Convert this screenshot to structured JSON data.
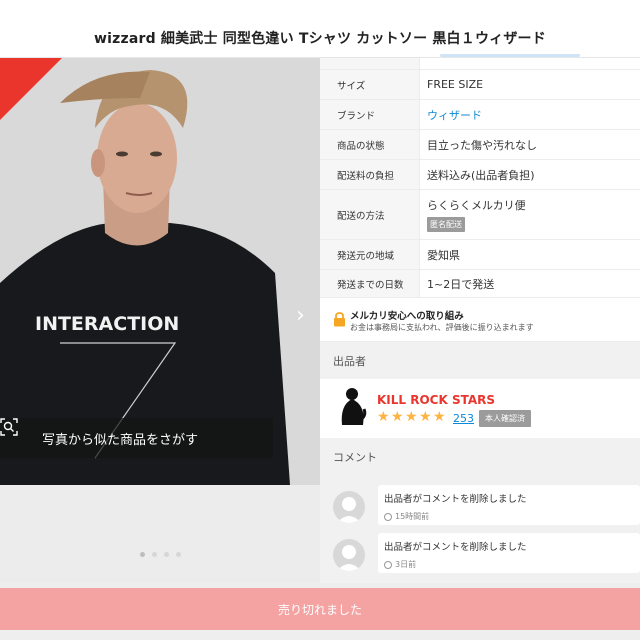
{
  "header": {
    "title": "wizzard 細美武士 同型色違い Tシャツ カットソー 黒白１ウィザード"
  },
  "gallery": {
    "search_similar_label": "写真から似た商品をさがす",
    "shirt_print": "INTERACTION",
    "dot_count": 4,
    "active_dot": 1
  },
  "details": {
    "rows": [
      {
        "label": "サイズ",
        "value": "FREE SIZE"
      },
      {
        "label": "ブランド",
        "value": "ウィザード"
      },
      {
        "label": "商品の状態",
        "value": "目立った傷や汚れなし"
      },
      {
        "label": "配送料の負担",
        "value": "送料込み(出品者負担)"
      },
      {
        "label": "配送の方法",
        "value": "らくらくメルカリ便",
        "tag": "匿名配送"
      },
      {
        "label": "発送元の地域",
        "value": "愛知県"
      },
      {
        "label": "発送までの日数",
        "value": "1~2日で発送"
      }
    ],
    "safety": {
      "title": "メルカリ安心への取り組み",
      "note": "お金は事務局に支払われ、評価後に振り込まれます"
    }
  },
  "seller": {
    "section_title": "出品者",
    "name": "KILL ROCK STARS",
    "rating_stars": 5,
    "rating_count": "253",
    "verified_badge": "本人確認済"
  },
  "comments": {
    "section_title": "コメント",
    "items": [
      {
        "text": "出品者がコメントを削除しました",
        "time": "15時間前"
      },
      {
        "text": "出品者がコメントを削除しました",
        "time": "3日前"
      }
    ]
  },
  "footer": {
    "sold_label": "売り切れました"
  },
  "colors": {
    "accent": "#ea352d",
    "link": "#0d8ad8",
    "star": "#ffb340",
    "sold_button": "#f5a3a2"
  }
}
